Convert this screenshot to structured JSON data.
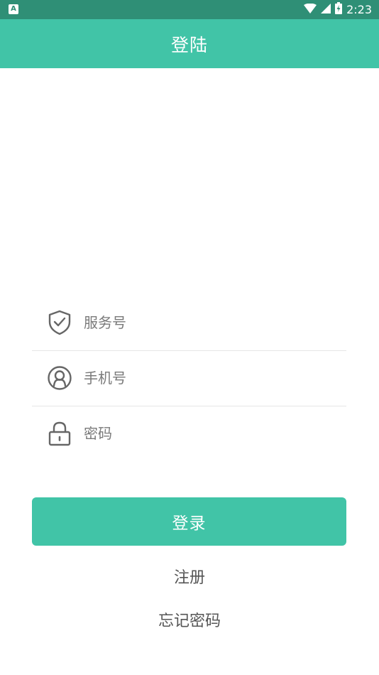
{
  "status_bar": {
    "app_icon_letter": "A",
    "time": "2:23",
    "icons": [
      "wifi-icon",
      "signal-icon",
      "battery-charging-icon"
    ],
    "background_color": "#2f8f76"
  },
  "header": {
    "title": "登陆",
    "background_color": "#41c4a7"
  },
  "form": {
    "service": {
      "icon": "shield-check-icon",
      "placeholder": "服务号",
      "value": ""
    },
    "phone": {
      "icon": "user-circle-icon",
      "placeholder": "手机号",
      "value": ""
    },
    "password": {
      "icon": "lock-icon",
      "placeholder": "密码",
      "value": ""
    }
  },
  "actions": {
    "login_label": "登录",
    "register_label": "注册",
    "forgot_label": "忘记密码",
    "accent_color": "#41c4a7"
  }
}
